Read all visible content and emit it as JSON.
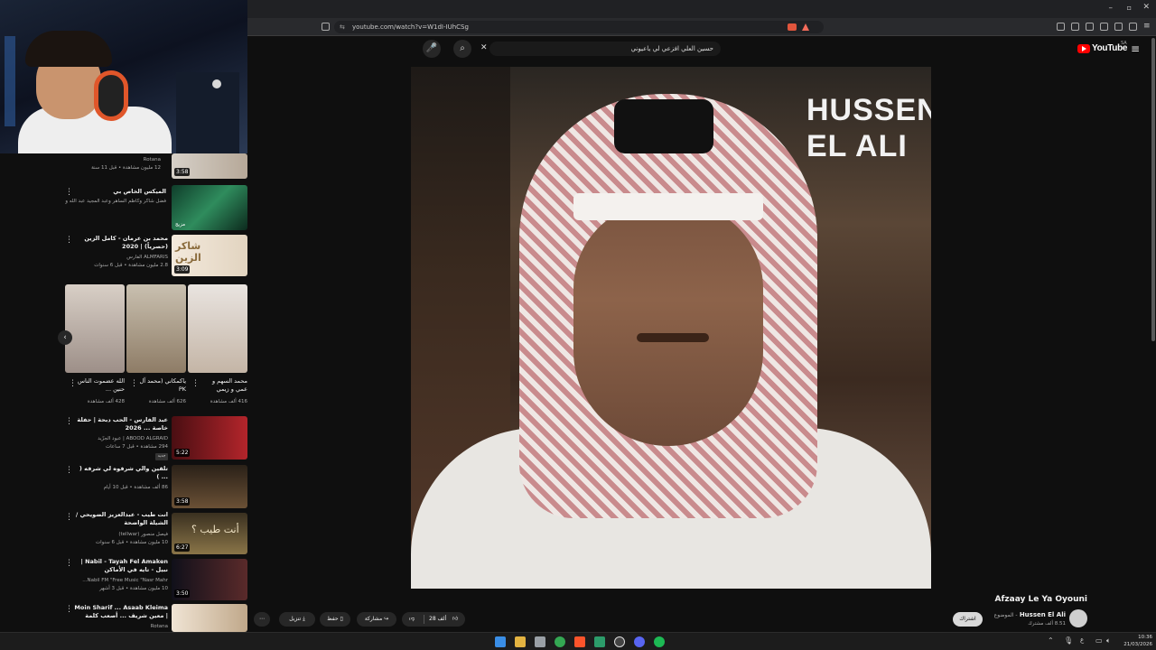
{
  "browser": {
    "url": "youtube.com/watch?v=W1dI-IUhCSg"
  },
  "youtube": {
    "logo_label": "YouTube",
    "logo_region": "SA",
    "search_query": "حسين العلي افزعي لي ياعيوني"
  },
  "video": {
    "overlay_title": "HUSSEN EL ALI",
    "title": "Afzaay Le Ya Oyouni",
    "channel": "Hussen El Ali",
    "channel_subtitle": "الموضوع -",
    "subscribers": "8.51 ألف مشترك",
    "subscribe_label": "اشتراك",
    "likes": "28 ألف",
    "share_label": "مشاركة",
    "save_label": "حفظ",
    "download_label": "تنزيل"
  },
  "sidebar": {
    "top_item": {
      "channel": "Rotana",
      "meta": "12 مليون مشاهدة • قبل 11 سنة",
      "duration": "3:58"
    },
    "videos": [
      {
        "title": "الميكس الخاص بي",
        "meta": "فضل شاكر وكاظم الساهر وعبد المجيد عبد الله والكثير غير ذلك",
        "badge": "مزيج"
      },
      {
        "title": "محمد بن عرمان - كامل الزين (حصرياً) | 2020",
        "channel": "ALMFARIS الفارس",
        "meta": "2.8 مليون مشاهدة • قبل 6 سنوات",
        "duration": "3:09"
      }
    ],
    "shorts": [
      {
        "title": "محمد السهم و عمي و زيمي",
        "views": "416 ألف مشاهدة"
      },
      {
        "title": "ياكمكاني (محمد آل PK",
        "views": "626 ألف مشاهدة"
      },
      {
        "title": "الله عضموت الناس حنين ...",
        "views": "428 ألف مشاهدة"
      }
    ],
    "more_videos": [
      {
        "title": "عبد الفارس - الحب دبحة | حفلة خاصة ... 2026",
        "channel": "ABOOD ALGRAID | عبود الجرّيد",
        "meta": "294 مشاهدة • قبل 7 ساعات",
        "duration": "5:22",
        "badge": "جديد"
      },
      {
        "title": "تلقين والي شرفوه لي شرفه ( ... )",
        "channel": "",
        "meta": "86 ألف مشاهدة • قبل 10 أيام",
        "duration": "3:58"
      },
      {
        "title": "انت طيب - عبدالعزيز الضويحي / الشيلة الواضحة",
        "channel": "فيصل منصور (tellwar)",
        "meta": "10 مليون مشاهدة • قبل 6 سنوات",
        "duration": "6:27"
      },
      {
        "title": "Nabil - Tayah Fel Amaken | نبيل - تايه في الأماكن",
        "channel": "Nabil FM \"Free Music \"Nasr Mahr...",
        "meta": "10 مليون مشاهدة • قبل 3 أشهر",
        "duration": "3:50"
      },
      {
        "title": "Moin Sharif ... Asaab Kleima | معين شريف ... أصعب كلمة",
        "channel": "Rotana",
        "meta": "",
        "duration": ""
      }
    ]
  },
  "taskbar": {
    "time": "10:36",
    "date": "21/03/2026",
    "lang": "ع"
  },
  "colors": {
    "youtube_red": "#ff0000",
    "accent": "#3ea6ff"
  }
}
